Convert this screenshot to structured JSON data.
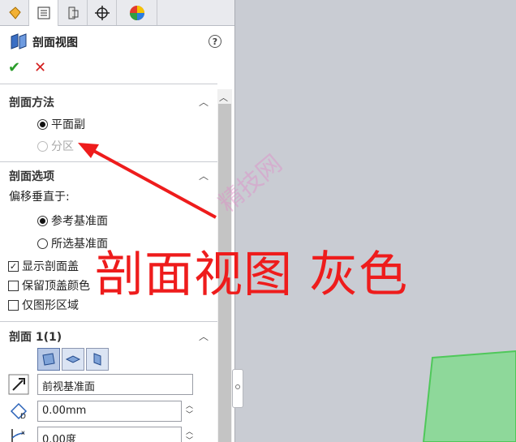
{
  "panel": {
    "title": "剖面视图",
    "help_label": "?",
    "ok_label": "✔",
    "cancel_label": "✕",
    "tabs": [
      "feature-manager-icon",
      "property-manager-icon",
      "configuration-manager-icon",
      "dimxpert-icon",
      "display-manager-icon"
    ]
  },
  "section_method": {
    "title": "剖面方法",
    "options": [
      {
        "label": "平面副",
        "selected": true,
        "enabled": true
      },
      {
        "label": "分区",
        "selected": false,
        "enabled": false
      }
    ]
  },
  "section_options": {
    "title": "剖面选项",
    "offset_label": "偏移垂直于:",
    "options": [
      {
        "label": "参考基准面",
        "selected": true
      },
      {
        "label": "所选基准面",
        "selected": false
      }
    ],
    "checks": [
      {
        "label": "显示剖面盖",
        "checked": true
      },
      {
        "label": "保留顶盖颜色",
        "checked": false
      },
      {
        "label": "仅图形区域",
        "checked": false
      }
    ]
  },
  "section1": {
    "title": "剖面 1(1)",
    "reference_plane": "前视基准面",
    "offset_distance": "0.00mm",
    "rotation_angle": "0.00度"
  },
  "annotation": {
    "text": "剖面视图 灰色",
    "color": "#ee1c1c"
  },
  "watermark": {
    "text": "精技网"
  },
  "colors": {
    "viewport": "#c9ccd3",
    "plane_fill": "#8ed89a",
    "plane_edge": "#4fc85a"
  }
}
